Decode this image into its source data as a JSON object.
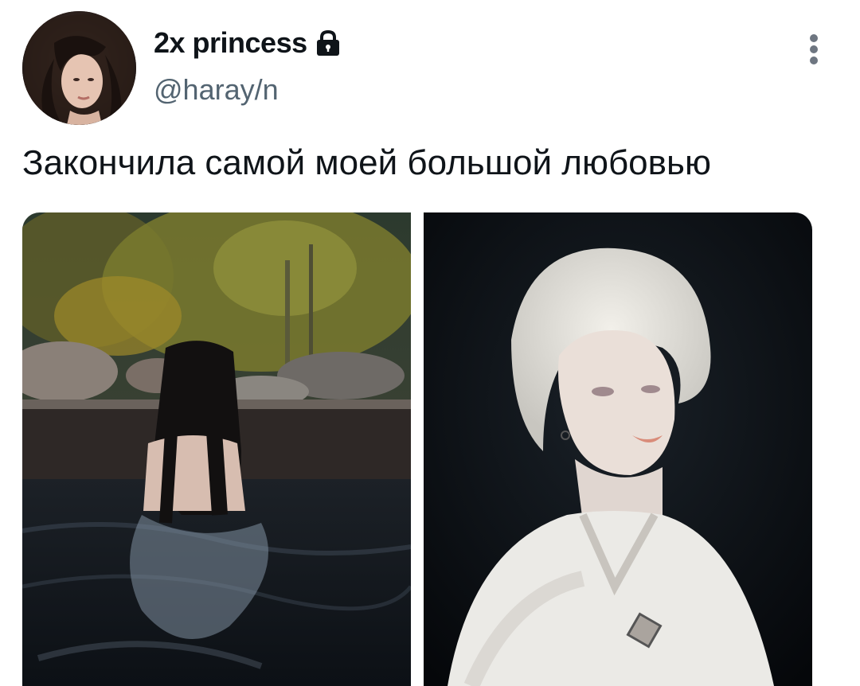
{
  "tweet": {
    "author": {
      "display_name": "2x princess",
      "handle": "@haray/n",
      "protected_icon": "lock-icon",
      "avatar": "profile-photo"
    },
    "text": "Закончила самой моей большой любовью",
    "media": [
      {
        "kind": "photo",
        "subject": "girl in hot spring"
      },
      {
        "kind": "photo",
        "subject": "painted portrait"
      }
    ],
    "more_icon": "more-vertical-icon"
  },
  "colors": {
    "text_primary": "#0f1419",
    "text_secondary": "#536471",
    "background": "#ffffff",
    "more_dots": "#6e7681"
  }
}
